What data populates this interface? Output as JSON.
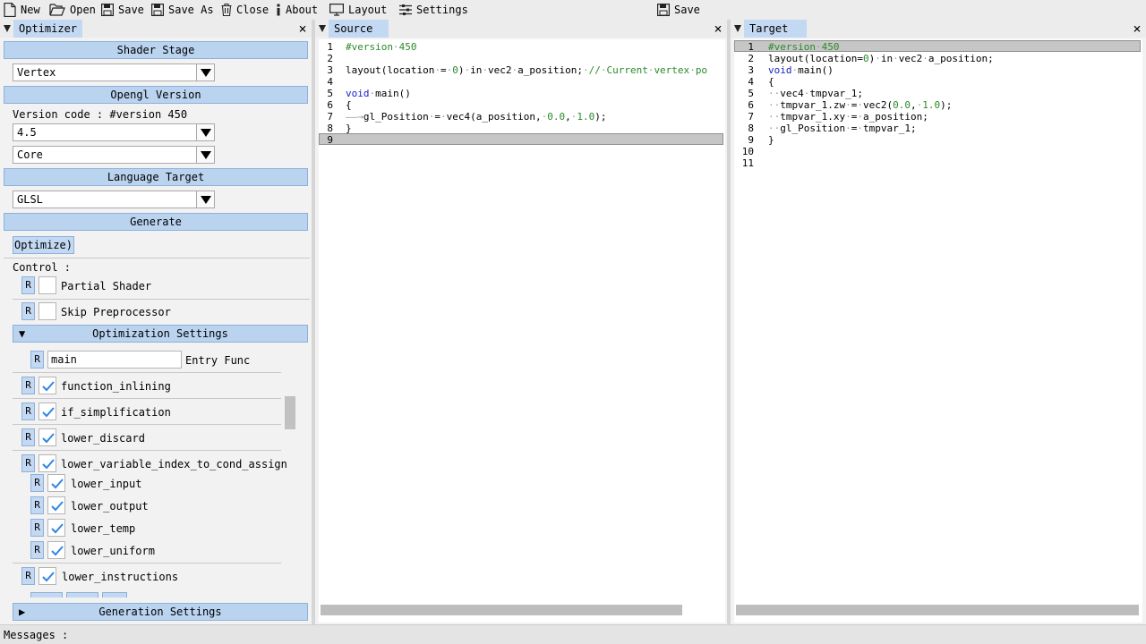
{
  "menubar": {
    "new": "New",
    "open": "Open",
    "save": "Save",
    "save_as": "Save As",
    "close": "Close",
    "about": "About",
    "layout": "Layout",
    "settings": "Settings",
    "save2": "Save"
  },
  "optimizer": {
    "tab": "Optimizer",
    "close": "×",
    "shader_stage": {
      "header": "Shader Stage",
      "value": "Vertex"
    },
    "opengl_version": {
      "header": "Opengl Version",
      "version_code": "Version code : #version 450",
      "version": "4.5",
      "profile": "Core"
    },
    "language_target": {
      "header": "Language Target",
      "value": "GLSL"
    },
    "generate": {
      "header": "Generate",
      "optimize_button": "Optimize)"
    },
    "control_label": "Control :",
    "reset_label": "R",
    "partial_shader": "Partial Shader",
    "skip_preprocessor": "Skip Preprocessor",
    "optimization_settings": {
      "header": "Optimization Settings",
      "entry_func_value": "main",
      "entry_func_label": "Entry Func",
      "options": [
        {
          "label": "function_inlining",
          "checked": true
        },
        {
          "label": "if_simplification",
          "checked": true
        },
        {
          "label": "lower_discard",
          "checked": true
        },
        {
          "label": "lower_variable_index_to_cond_assign",
          "checked": true
        }
      ],
      "sub_options": [
        {
          "label": "lower_input",
          "checked": true
        },
        {
          "label": "lower_output",
          "checked": true
        },
        {
          "label": "lower_temp",
          "checked": true
        },
        {
          "label": "lower_uniform",
          "checked": true
        }
      ],
      "lower_instructions": {
        "label": "lower_instructions",
        "checked": true
      }
    },
    "generation_settings": {
      "header": "Generation Settings"
    }
  },
  "source": {
    "tab": "Source",
    "close": "×",
    "line_numbers": [
      "1",
      "2",
      "3",
      "4",
      "5",
      "6",
      "7",
      "8",
      "9"
    ]
  },
  "target": {
    "tab": "Target",
    "close": "×",
    "line_numbers": [
      "1",
      "2",
      "3",
      "4",
      "5",
      "6",
      "7",
      "8",
      "9",
      "10",
      "11"
    ]
  },
  "status": {
    "messages": "Messages :"
  }
}
